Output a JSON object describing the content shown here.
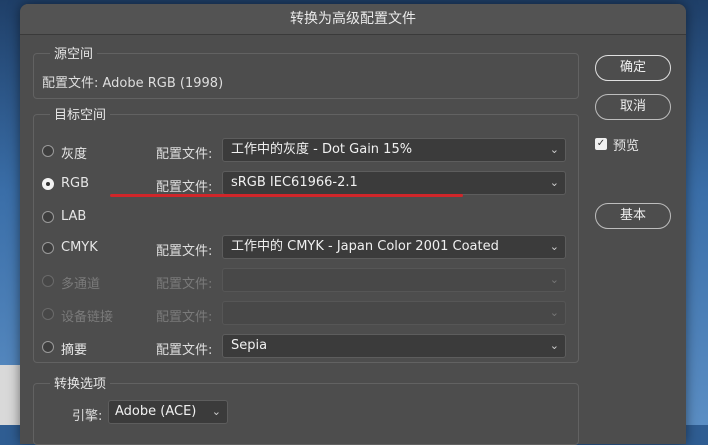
{
  "dialog": {
    "title": "转换为高级配置文件"
  },
  "source": {
    "title": "源空间",
    "profile_text": "配置文件:  Adobe RGB (1998)"
  },
  "destination": {
    "title": "目标空间",
    "profile_label": "配置文件:",
    "rows": [
      {
        "label": "灰度",
        "selected": false,
        "enabled": true,
        "value": "工作中的灰度 - Dot Gain 15%"
      },
      {
        "label": "RGB",
        "selected": true,
        "enabled": true,
        "value": "sRGB IEC61966-2.1"
      },
      {
        "label": "LAB",
        "selected": false,
        "enabled": true,
        "value": ""
      },
      {
        "label": "CMYK",
        "selected": false,
        "enabled": true,
        "value": "工作中的 CMYK - Japan Color 2001 Coated"
      },
      {
        "label": "多通道",
        "selected": false,
        "enabled": false,
        "value": ""
      },
      {
        "label": "设备链接",
        "selected": false,
        "enabled": false,
        "value": ""
      },
      {
        "label": "摘要",
        "selected": false,
        "enabled": true,
        "value": "Sepia"
      }
    ]
  },
  "conversion": {
    "title": "转换选项",
    "engine_label": "引擎:",
    "engine_value": "Adobe (ACE)"
  },
  "buttons": {
    "ok": "确定",
    "cancel": "取消",
    "basic": "基本"
  },
  "preview": {
    "label": "预览",
    "checked": true
  },
  "colors": {
    "annotation_line": "#d0262a"
  }
}
